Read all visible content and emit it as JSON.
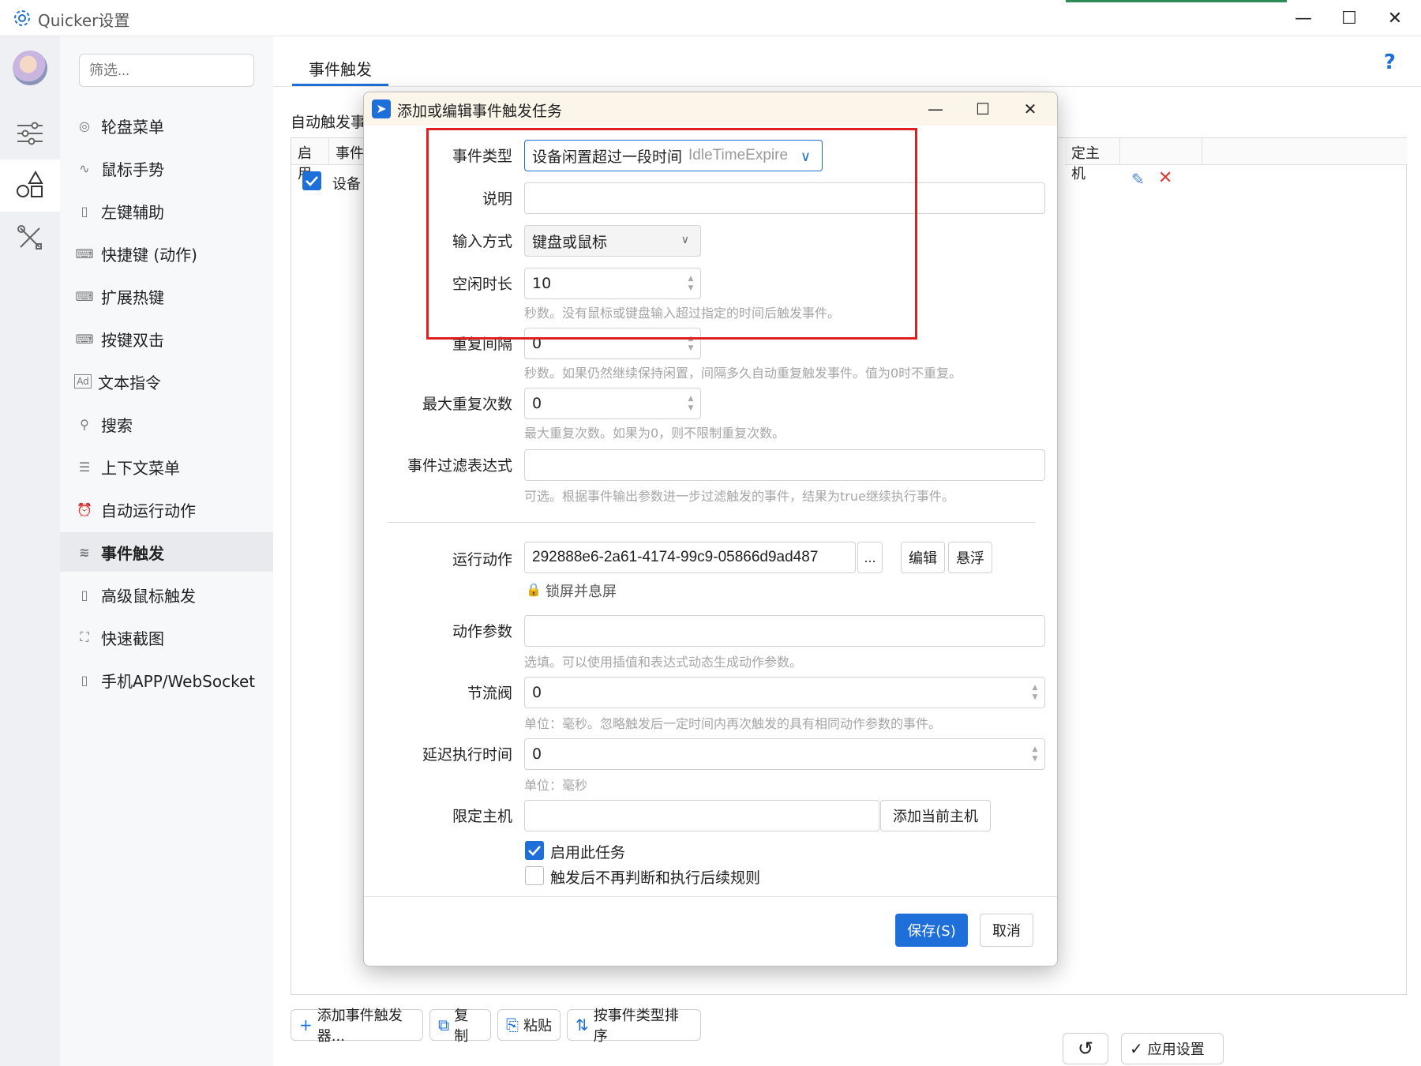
{
  "window": {
    "title": "Quicker设置",
    "minimize": "—",
    "maximize": "☐",
    "close": "✕"
  },
  "sidebar": {
    "filter_placeholder": "筛选...",
    "items": [
      {
        "label": "轮盘菜单",
        "icon": "wheel-icon"
      },
      {
        "label": "鼠标手势",
        "icon": "gesture-icon"
      },
      {
        "label": "左键辅助",
        "icon": "mouse-icon"
      },
      {
        "label": "快捷键 (动作)",
        "icon": "keyboard-icon"
      },
      {
        "label": "扩展热键",
        "icon": "keyboard-icon"
      },
      {
        "label": "按键双击",
        "icon": "keyboard-icon"
      },
      {
        "label": "文本指令",
        "icon": "ad-icon"
      },
      {
        "label": "搜索",
        "icon": "search-icon"
      },
      {
        "label": "上下文菜单",
        "icon": "menu-icon"
      },
      {
        "label": "自动运行动作",
        "icon": "alarm-icon"
      },
      {
        "label": "事件触发",
        "icon": "wind-icon",
        "active": true
      },
      {
        "label": "高级鼠标触发",
        "icon": "mouse-icon"
      },
      {
        "label": "快速截图",
        "icon": "screenshot-icon"
      },
      {
        "label": "手机APP/WebSocket",
        "icon": "phone-icon"
      }
    ]
  },
  "main": {
    "tab": "事件触发",
    "help": "?",
    "section_label": "自动触发事",
    "columns": [
      "启用",
      "事件",
      "定主机"
    ],
    "row": {
      "enabled": true,
      "text": "设备"
    },
    "buttons": {
      "add": "添加事件触发器...",
      "copy": "复制",
      "paste": "粘贴",
      "sort": "按事件类型排序",
      "apply": "应用设置"
    }
  },
  "dialog": {
    "title": "添加或编辑事件触发任务",
    "event_type": {
      "label": "事件类型",
      "value": "设备闲置超过一段时间",
      "code": "IdleTimeExpire"
    },
    "description": {
      "label": "说明",
      "value": ""
    },
    "input_mode": {
      "label": "输入方式",
      "value": "键盘或鼠标"
    },
    "idle_duration": {
      "label": "空闲时长",
      "value": "10",
      "hint": "秒数。没有鼠标或键盘输入超过指定的时间后触发事件。"
    },
    "repeat_interval": {
      "label": "重复间隔",
      "value": "0",
      "hint": "秒数。如果仍然继续保持闲置，间隔多久自动重复触发事件。值为0时不重复。"
    },
    "max_repeat": {
      "label": "最大重复次数",
      "value": "0",
      "hint": "最大重复次数。如果为0，则不限制重复次数。"
    },
    "filter_expr": {
      "label": "事件过滤表达式",
      "value": "",
      "hint": "可选。根据事件输出参数进一步过滤触发的事件，结果为true继续执行事件。"
    },
    "run_action": {
      "label": "运行动作",
      "value": "292888e6-2a61-4174-99c9-05866d9ad487",
      "browse": "...",
      "edit": "编辑",
      "float": "悬浮",
      "action_name": "锁屏并息屏"
    },
    "action_params": {
      "label": "动作参数",
      "value": "",
      "hint": "选填。可以使用插值和表达式动态生成动作参数。"
    },
    "throttle": {
      "label": "节流阀",
      "value": "0",
      "hint": "单位：毫秒。忽略触发后一定时间内再次触发的具有相同动作参数的事件。"
    },
    "delay": {
      "label": "延迟执行时间",
      "value": "0",
      "hint": "单位：毫秒"
    },
    "host": {
      "label": "限定主机",
      "value": "",
      "add_btn": "添加当前主机"
    },
    "enable_task": {
      "label": "启用此任务",
      "checked": true
    },
    "stop_after": {
      "label": "触发后不再判断和执行后续规则",
      "checked": false
    },
    "save": "保存(S)",
    "cancel": "取消"
  },
  "colors": {
    "accent": "#1e6fd9",
    "highlight_box": "#e02020"
  }
}
